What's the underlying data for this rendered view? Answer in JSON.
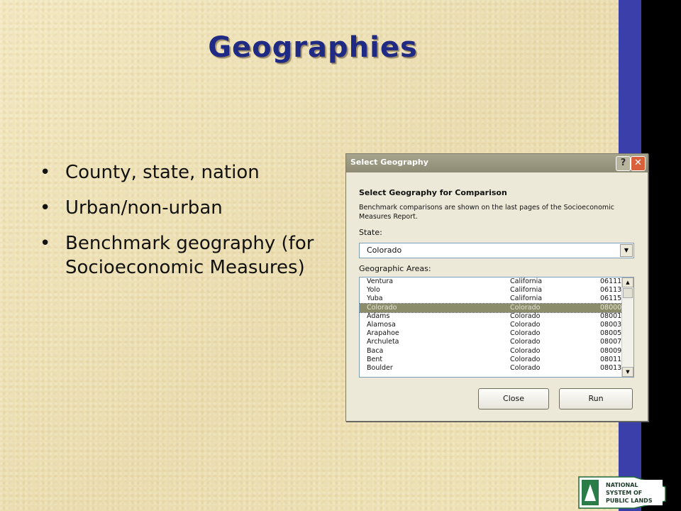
{
  "slide": {
    "title": "Geographies",
    "bullets": [
      "County, state, nation",
      "Urban/non-urban",
      "Benchmark geography (for Socioeconomic Measures)"
    ]
  },
  "dialog": {
    "title": "Select Geography",
    "help_label": "?",
    "close_label": "✕",
    "heading": "Select Geography for Comparison",
    "description": "Benchmark comparisons are shown on the last pages of the Socioeconomic Measures Report.",
    "state_label": "State:",
    "state_value": "Colorado",
    "areas_label": "Geographic Areas:",
    "rows": [
      {
        "name": "Ventura",
        "state": "California",
        "code": "06111"
      },
      {
        "name": "Yolo",
        "state": "California",
        "code": "06113"
      },
      {
        "name": "Yuba",
        "state": "California",
        "code": "06115"
      },
      {
        "name": "Colorado",
        "state": "Colorado",
        "code": "08000"
      },
      {
        "name": "Adams",
        "state": "Colorado",
        "code": "08001"
      },
      {
        "name": "Alamosa",
        "state": "Colorado",
        "code": "08003"
      },
      {
        "name": "Arapahoe",
        "state": "Colorado",
        "code": "08005"
      },
      {
        "name": "Archuleta",
        "state": "Colorado",
        "code": "08007"
      },
      {
        "name": "Baca",
        "state": "Colorado",
        "code": "08009"
      },
      {
        "name": "Bent",
        "state": "Colorado",
        "code": "08011"
      },
      {
        "name": "Boulder",
        "state": "Colorado",
        "code": "08013"
      }
    ],
    "selected_row": 3,
    "close_button": "Close",
    "run_button": "Run"
  },
  "logo": {
    "text": "NATIONAL SYSTEM OF PUBLIC LANDS"
  },
  "colors": {
    "title": "#1f2a84",
    "side_bar": "#3a3faa",
    "selection": "#8a8c6a"
  }
}
